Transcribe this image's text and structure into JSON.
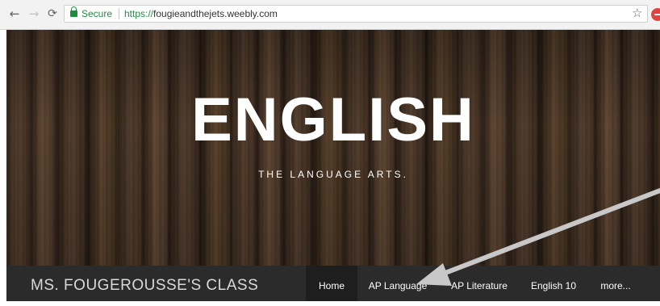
{
  "browser": {
    "secure_label": "Secure",
    "url_scheme": "https://",
    "url_host": "fougieandthejets.weebly.com",
    "icons": [
      "back-icon",
      "forward-icon",
      "reload-icon",
      "lock-icon",
      "star-icon",
      "extension-icon"
    ]
  },
  "hero": {
    "title": "ENGLISH",
    "subtitle": "THE LANGUAGE ARTS."
  },
  "navbar": {
    "site_title": "MS. FOUGEROUSSE'S CLASS",
    "items": [
      {
        "label": "Home",
        "active": true
      },
      {
        "label": "AP Language"
      },
      {
        "label": "AP Literature"
      },
      {
        "label": "English 10"
      },
      {
        "label": "more..."
      }
    ]
  },
  "annotation": {
    "arrow_color": "#c8c8c8",
    "points_to": "AP Language"
  },
  "colors": {
    "secure_green": "#1e8e3e",
    "nav_bg": "#2b2b2b",
    "nav_active_bg": "#1e1e1e"
  }
}
